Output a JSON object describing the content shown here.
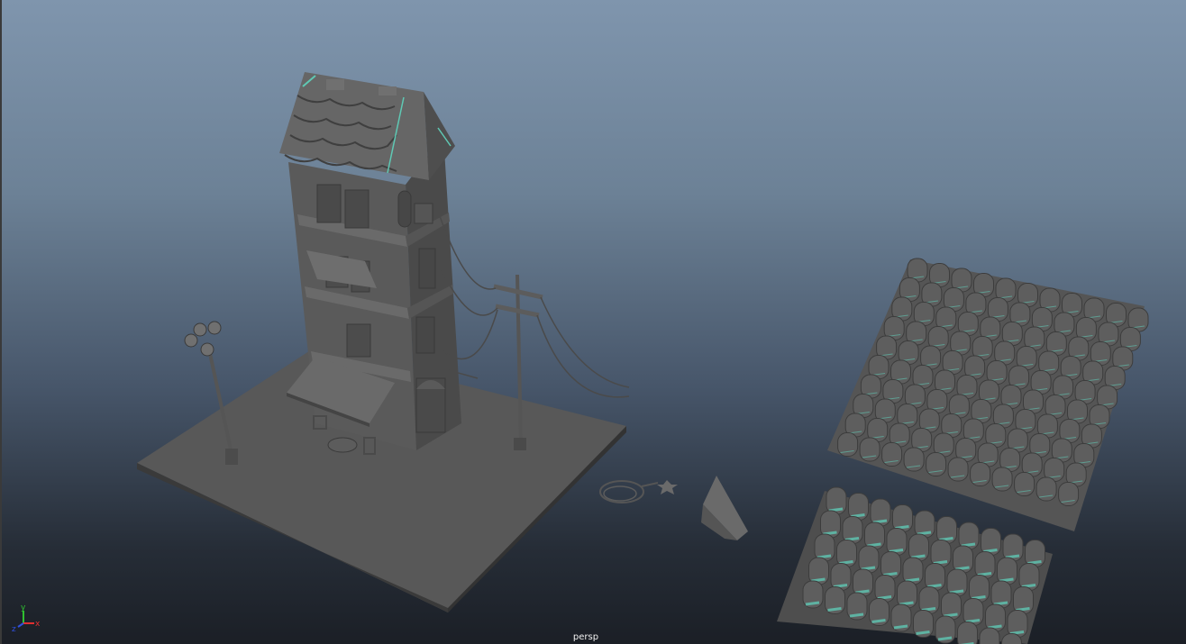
{
  "viewport": {
    "camera_label": "persp",
    "axis_labels": {
      "x": "x",
      "y": "y",
      "z": "z"
    }
  },
  "colors": {
    "bg_top": "#7f95ad",
    "bg_bottom": "#1b1f26",
    "mesh": "#5e5e5e",
    "mesh_dark": "#3c3c3c",
    "mesh_light": "#787878",
    "highlight": "#5fc8b4",
    "axis_x": "#e03030",
    "axis_y": "#30c030",
    "axis_z": "#3050e0"
  },
  "scene_objects": [
    "ground-plane",
    "house",
    "street-lamp",
    "utility-pole",
    "cables",
    "rope-coil",
    "wedge-block",
    "roof-tiles-large",
    "roof-tiles-small"
  ]
}
